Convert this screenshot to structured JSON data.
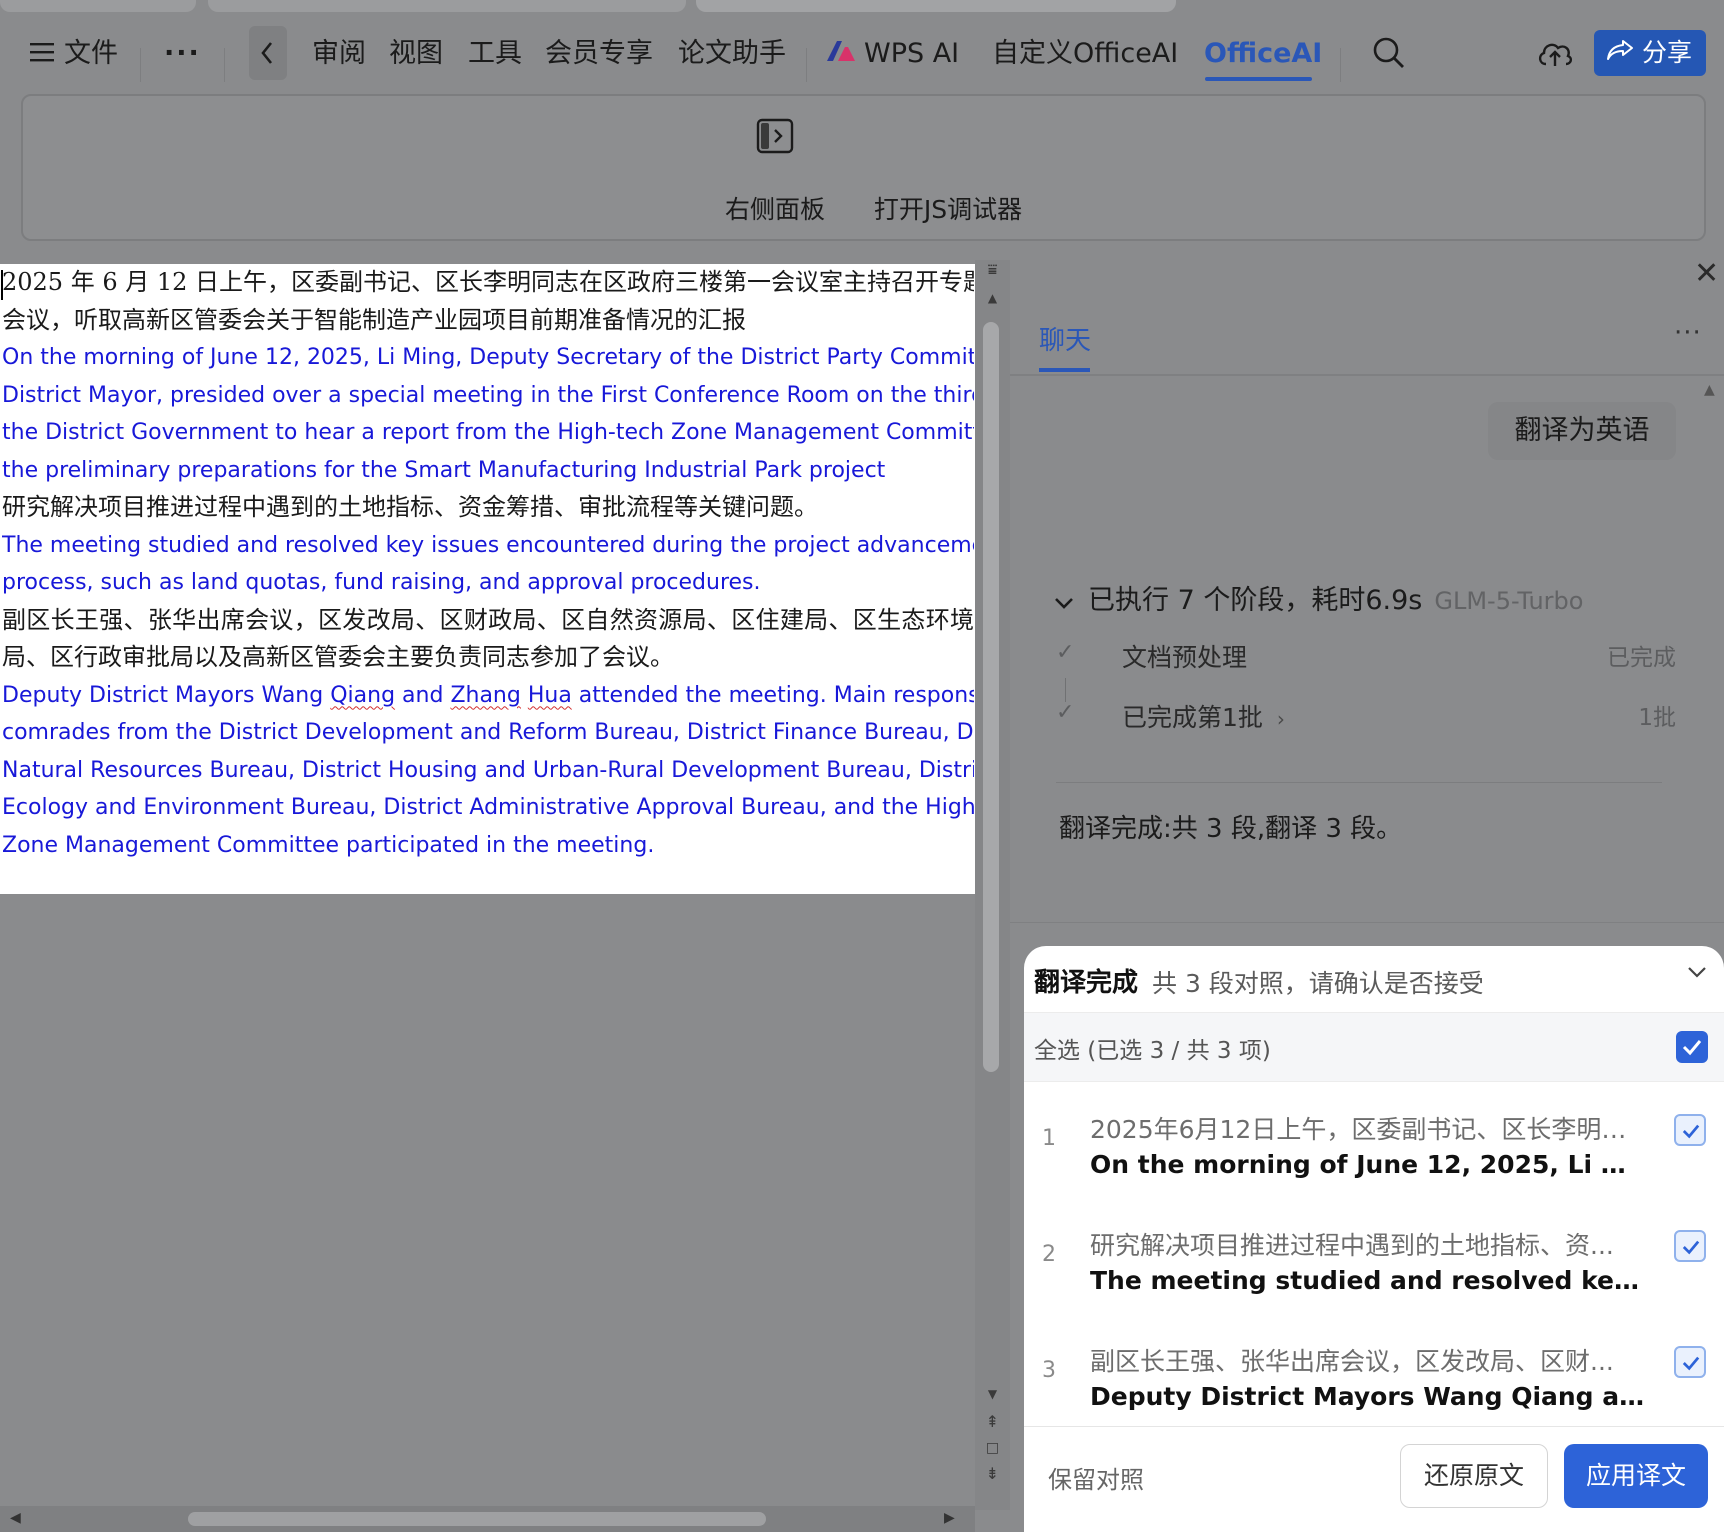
{
  "menu": {
    "file_label": "文件",
    "more_dots": "···",
    "items": [
      "审阅",
      "视图",
      "工具",
      "会员专享",
      "论文助手"
    ],
    "wps_ai": "WPS AI",
    "custom_officeai": "自定义OfficeAI",
    "officeai": "OfficeAI",
    "share": "分享"
  },
  "ribbon": {
    "right_panel": "右侧面板",
    "js_debugger": "打开JS调试器"
  },
  "document": {
    "p1_zh_lines": [
      "2025 年 6 月 12 日上午，区委副书记、区长李明同志在区政府三楼第一会议室主持召开专题",
      "会议，听取高新区管委会关于智能制造产业园项目前期准备情况的汇报"
    ],
    "p1_en_lines": [
      "On the morning of June 12, 2025, Li Ming, Deputy Secretary of the District Party Committee and",
      "District Mayor, presided over a special meeting in the First Conference Room on the third floor of",
      "the District Government to hear a report from the High-tech Zone Management Committee on",
      "the preliminary preparations for the Smart Manufacturing Industrial Park project"
    ],
    "p2_zh_lines": [
      "研究解决项目推进过程中遇到的土地指标、资金筹措、审批流程等关键问题。"
    ],
    "p2_en_lines": [
      "The meeting studied and resolved key issues encountered during the project advancement",
      "process, such as land quotas, fund raising, and approval procedures."
    ],
    "p3_zh_lines": [
      "副区长王强、张华出席会议，区发改局、区财政局、区自然资源局、区住建局、区生态环境",
      "局、区行政审批局以及高新区管委会主要负责同志参加了会议。"
    ],
    "p3_en": {
      "l1_a": "Deputy District Mayors Wang ",
      "l1_qiang": "Qiang",
      "l1_b": " and ",
      "l1_zhang": "Zhang",
      "l1_c": " ",
      "l1_hua": "Hua",
      "l1_d": " attended the meeting. Main responsible",
      "rest": [
        "comrades from the District Development and Reform Bureau, District Finance Bureau, District",
        "Natural Resources Bureau, District Housing and Urban-Rural Development Bureau, District",
        "Ecology and Environment Bureau, District Administrative Approval Bureau, and the High-tech",
        "Zone Management Committee participated in the meeting."
      ]
    }
  },
  "panel": {
    "chat_tab": "聊天",
    "more": "···",
    "user_message": "翻译为英语",
    "stages_summary": "已执行 7 个阶段，耗时6.9s",
    "model": "GLM-5-Turbo",
    "steps": [
      {
        "label": "文档预处理",
        "status": "已完成"
      },
      {
        "label": "已完成第1批",
        "status": "1批"
      }
    ],
    "result_message": "翻译完成:共 3 段,翻译 3 段。"
  },
  "confirm_card": {
    "title": "翻译完成",
    "subtitle": "共 3 段对照，请确认是否接受",
    "select_all": "全选 (已选 3 / 共 3 项)",
    "select_all_checked": true,
    "items": [
      {
        "num": "1",
        "src": "2025年6月12日上午，区委副书记、区长李明同...",
        "dst": "On the morning of June 12, 2025, Li Ming, De...",
        "checked": true
      },
      {
        "num": "2",
        "src": "研究解决项目推进过程中遇到的土地指标、资...",
        "dst": "The meeting studied and resolved key issues ...",
        "checked": true
      },
      {
        "num": "3",
        "src": "副区长王强、张华出席会议，区发改局、区财...",
        "dst": "Deputy District Mayors Wang Qiang and Zha...",
        "checked": true
      }
    ],
    "keep_compare": "保留对照",
    "restore": "还原原文",
    "apply": "应用译文"
  },
  "colors": {
    "accent": "#2a57b8",
    "primary_button": "#2d63d8",
    "translation_text": "#1818d8",
    "overlay_gray": "#8a8b8d"
  },
  "icons": [
    "hamburger-icon",
    "more-icon",
    "chevron-left-icon",
    "wps-ai-logo-icon",
    "search-icon",
    "cloud-upload-icon",
    "share-icon",
    "side-panel-icon",
    "close-icon",
    "chevron-down-icon",
    "check-icon",
    "chevron-right-icon",
    "checkbox-checked-icon"
  ]
}
